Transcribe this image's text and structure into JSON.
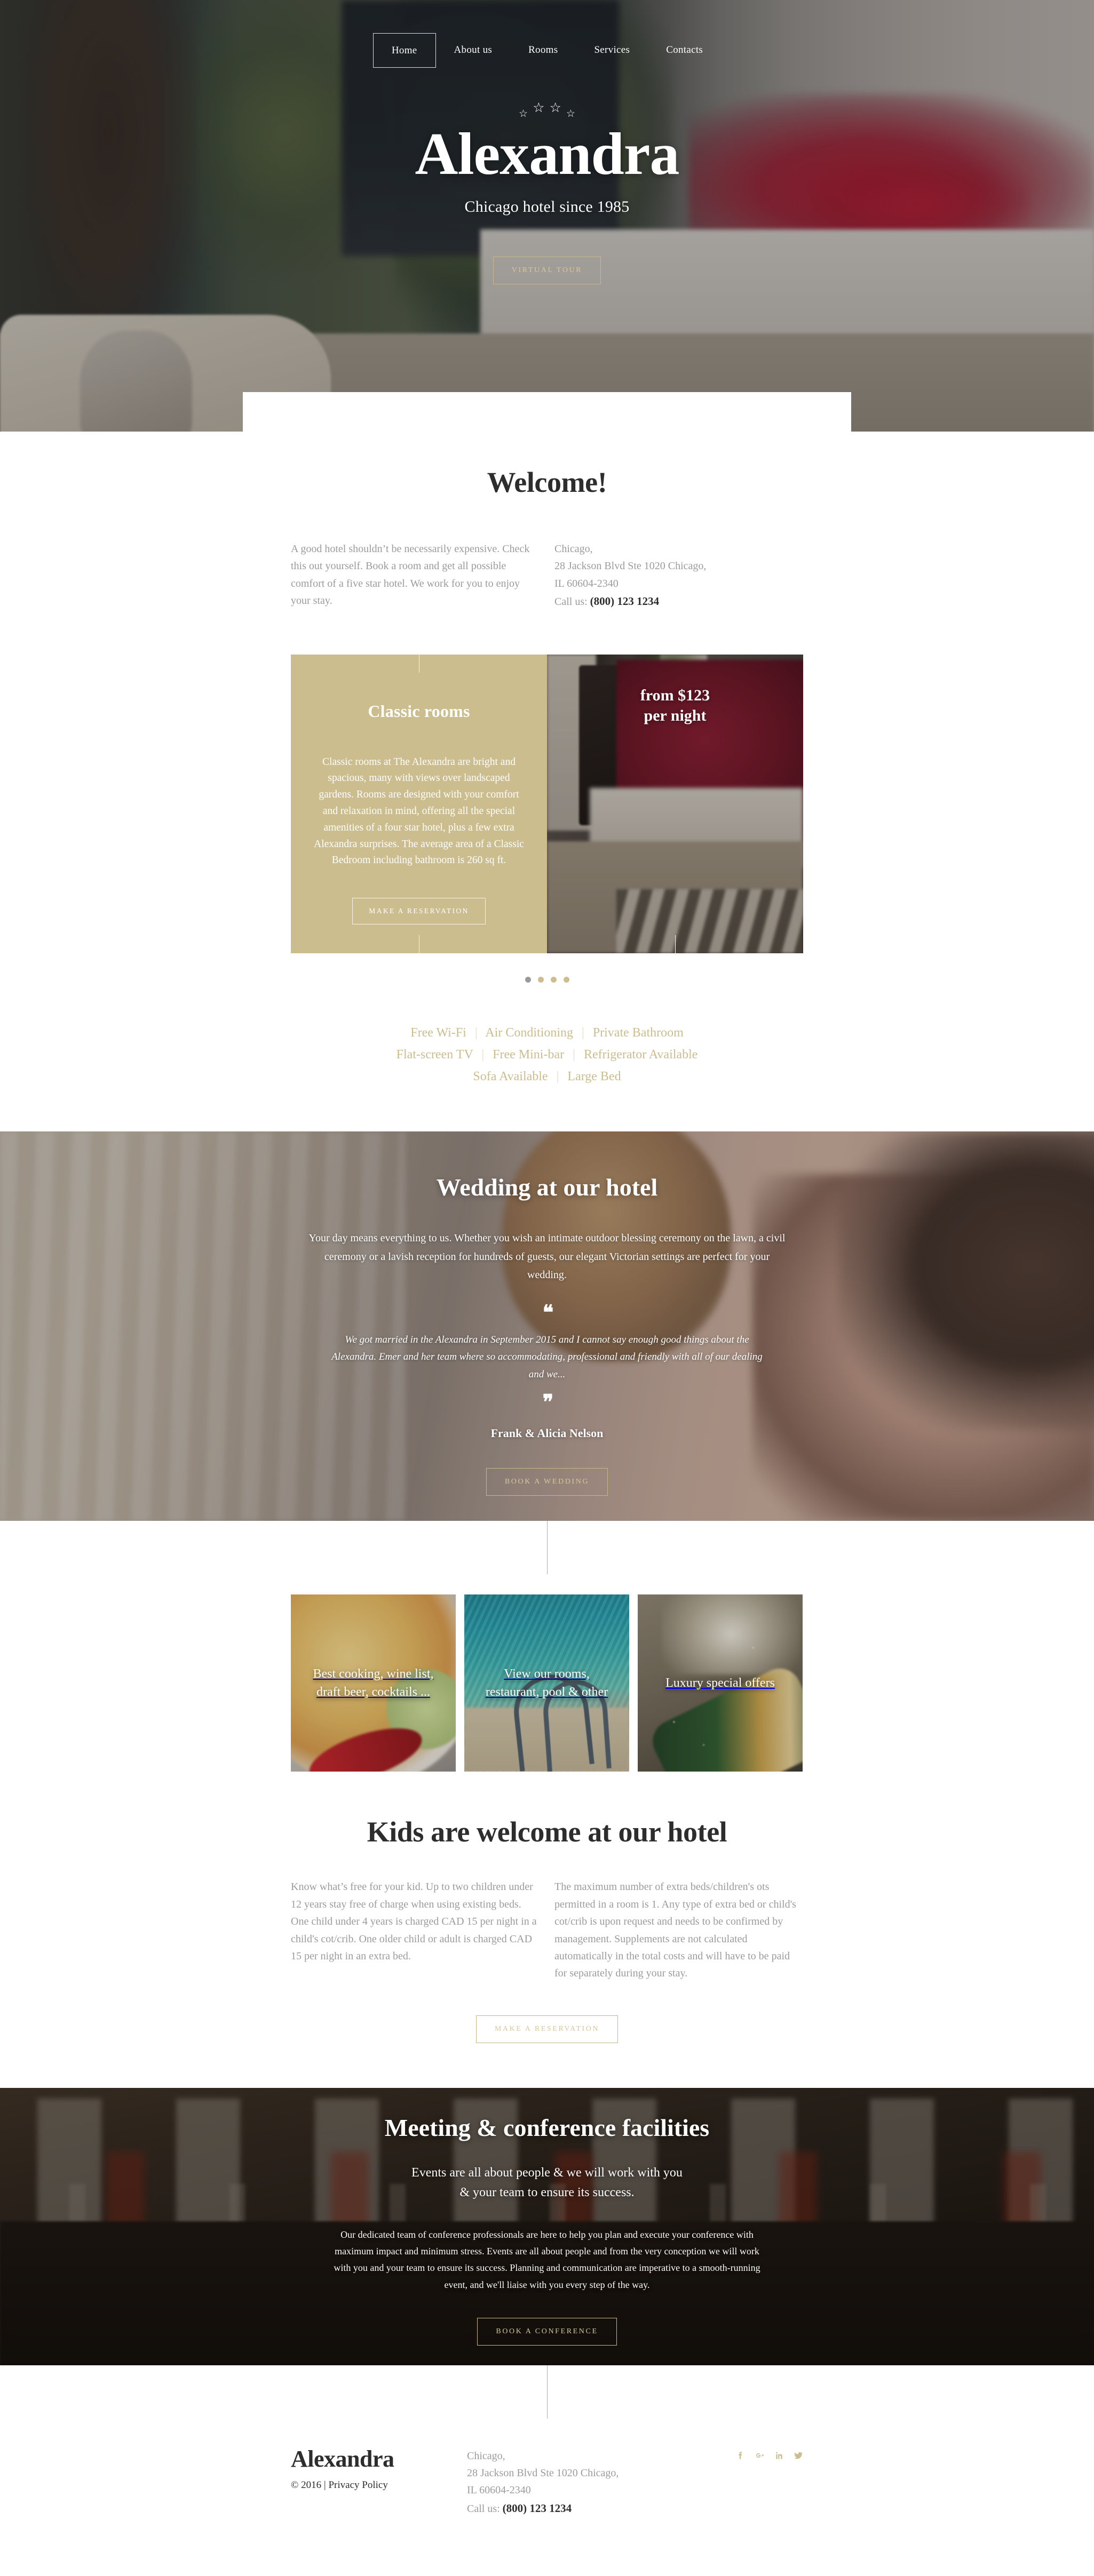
{
  "nav": {
    "items": [
      {
        "label": "Home",
        "active": true
      },
      {
        "label": "About us",
        "active": false
      },
      {
        "label": "Rooms",
        "active": false
      },
      {
        "label": "Services",
        "active": false
      },
      {
        "label": "Contacts",
        "active": false
      }
    ]
  },
  "hero": {
    "stars": "4",
    "title": "Alexandra",
    "subtitle": "Chicago hotel since 1985",
    "cta": "VIRTUAL TOUR"
  },
  "welcome": {
    "title": "Welcome!",
    "paragraph": "A good hotel shouldn’t be necessarily expensive. Check this out yourself. Book a room and get all possible comfort of a five star hotel. We work for you to enjoy your stay.",
    "address_line1": "Chicago,",
    "address_line2": "28 Jackson Blvd Ste 1020 Chicago,",
    "address_line3": "IL 60604-2340",
    "call_label": "Call us:",
    "phone": "(800) 123 1234"
  },
  "rooms": {
    "heading": "Classic rooms",
    "description": "Classic rooms at The Alexandra are bright and spacious, many with views over landscaped gardens. Rooms are designed with your comfort and relaxation in mind, offering all the special amenities of a four star hotel, plus a few extra Alexandra surprises. The average area of a Classic Bedroom including bathroom is 260 sq ft.",
    "cta": "MAKE A RESERVATION",
    "price_line1": "from $123",
    "price_line2": "per night",
    "dots": 4,
    "active_dot": 0
  },
  "amenities": {
    "rows": [
      [
        "Free Wi-Fi",
        "Air Conditioning",
        "Private Bathroom"
      ],
      [
        "Flat-screen TV",
        "Free Mini-bar",
        "Refrigerator Available"
      ],
      [
        "Sofa Available",
        "Large Bed"
      ]
    ],
    "separator": "|"
  },
  "wedding": {
    "title": "Wedding at our hotel",
    "intro": "Your day means everything to us. Whether you wish an intimate outdoor blessing ceremony on the lawn, a civil ceremony or a lavish reception for hundreds of guests, our elegant Victorian settings are perfect for your wedding.",
    "quote_open": "❝",
    "quote_close": "❞",
    "quote": "We got married in the Alexandra in September 2015 and I cannot say enough good things about the Alexandra. Emer and her team where so accommodating, professional and friendly with all of our dealing and we...",
    "author": "Frank & Alicia Nelson",
    "cta": "BOOK A WEDDING"
  },
  "features": {
    "cards": [
      {
        "label": "Best cooking, wine list, draft beer, cocktails ..."
      },
      {
        "label": "View our rooms, restaurant, pool & other"
      },
      {
        "label": "Luxury special offers"
      }
    ]
  },
  "kids": {
    "title": "Kids are welcome at our hotel",
    "paragraph_left": "Know what’s free for your kid. Up to two children under 12 years stay free of charge when using existing beds. One child under 4 years is charged CAD 15 per night in a child's cot/crib. One older child or adult is charged CAD 15 per night in an extra bed.",
    "paragraph_right": "The maximum number of extra beds/children's ots permitted in a room is 1. Any type of extra bed or child's cot/crib is upon request and needs to be confirmed by management. Supplements are not calculated automatically in the total costs and will have to be paid for separately during your stay.",
    "cta": "MAKE A RESERVATION"
  },
  "conference": {
    "title": "Meeting & conference facilities",
    "lead_line1": "Events are all about people & we will work with you",
    "lead_line2": "& your team to ensure its success.",
    "body": "Our dedicated team of conference professionals are here to help you plan and execute your conference with maximum impact and minimum stress. Events are all about people and from the very conception we will work with you and your team to ensure its success. Planning and communication are imperative to a smooth-running event, and we'll liaise with you every step of the way.",
    "cta": "BOOK A CONFERENCE"
  },
  "footer": {
    "logo": "Alexandra",
    "copyright": "© 2016 | Privacy Policy",
    "address_line1": "Chicago,",
    "address_line2": "28 Jackson Blvd Ste 1020 Chicago,",
    "address_line3": "IL 60604-2340",
    "call_label": "Call us:",
    "phone": "(800) 123 1234",
    "social": [
      {
        "name": "facebook-icon",
        "glyph": "f"
      },
      {
        "name": "google-plus-icon",
        "glyph": "g+"
      },
      {
        "name": "linkedin-icon",
        "glyph": "in"
      },
      {
        "name": "twitter-icon",
        "glyph": "t"
      }
    ]
  },
  "colors": {
    "accent_gold": "#cbbd8e",
    "accent_gold_line": "#c6ab6e",
    "dark_text": "#2d2d2d",
    "muted_text": "#9b9b9b"
  }
}
